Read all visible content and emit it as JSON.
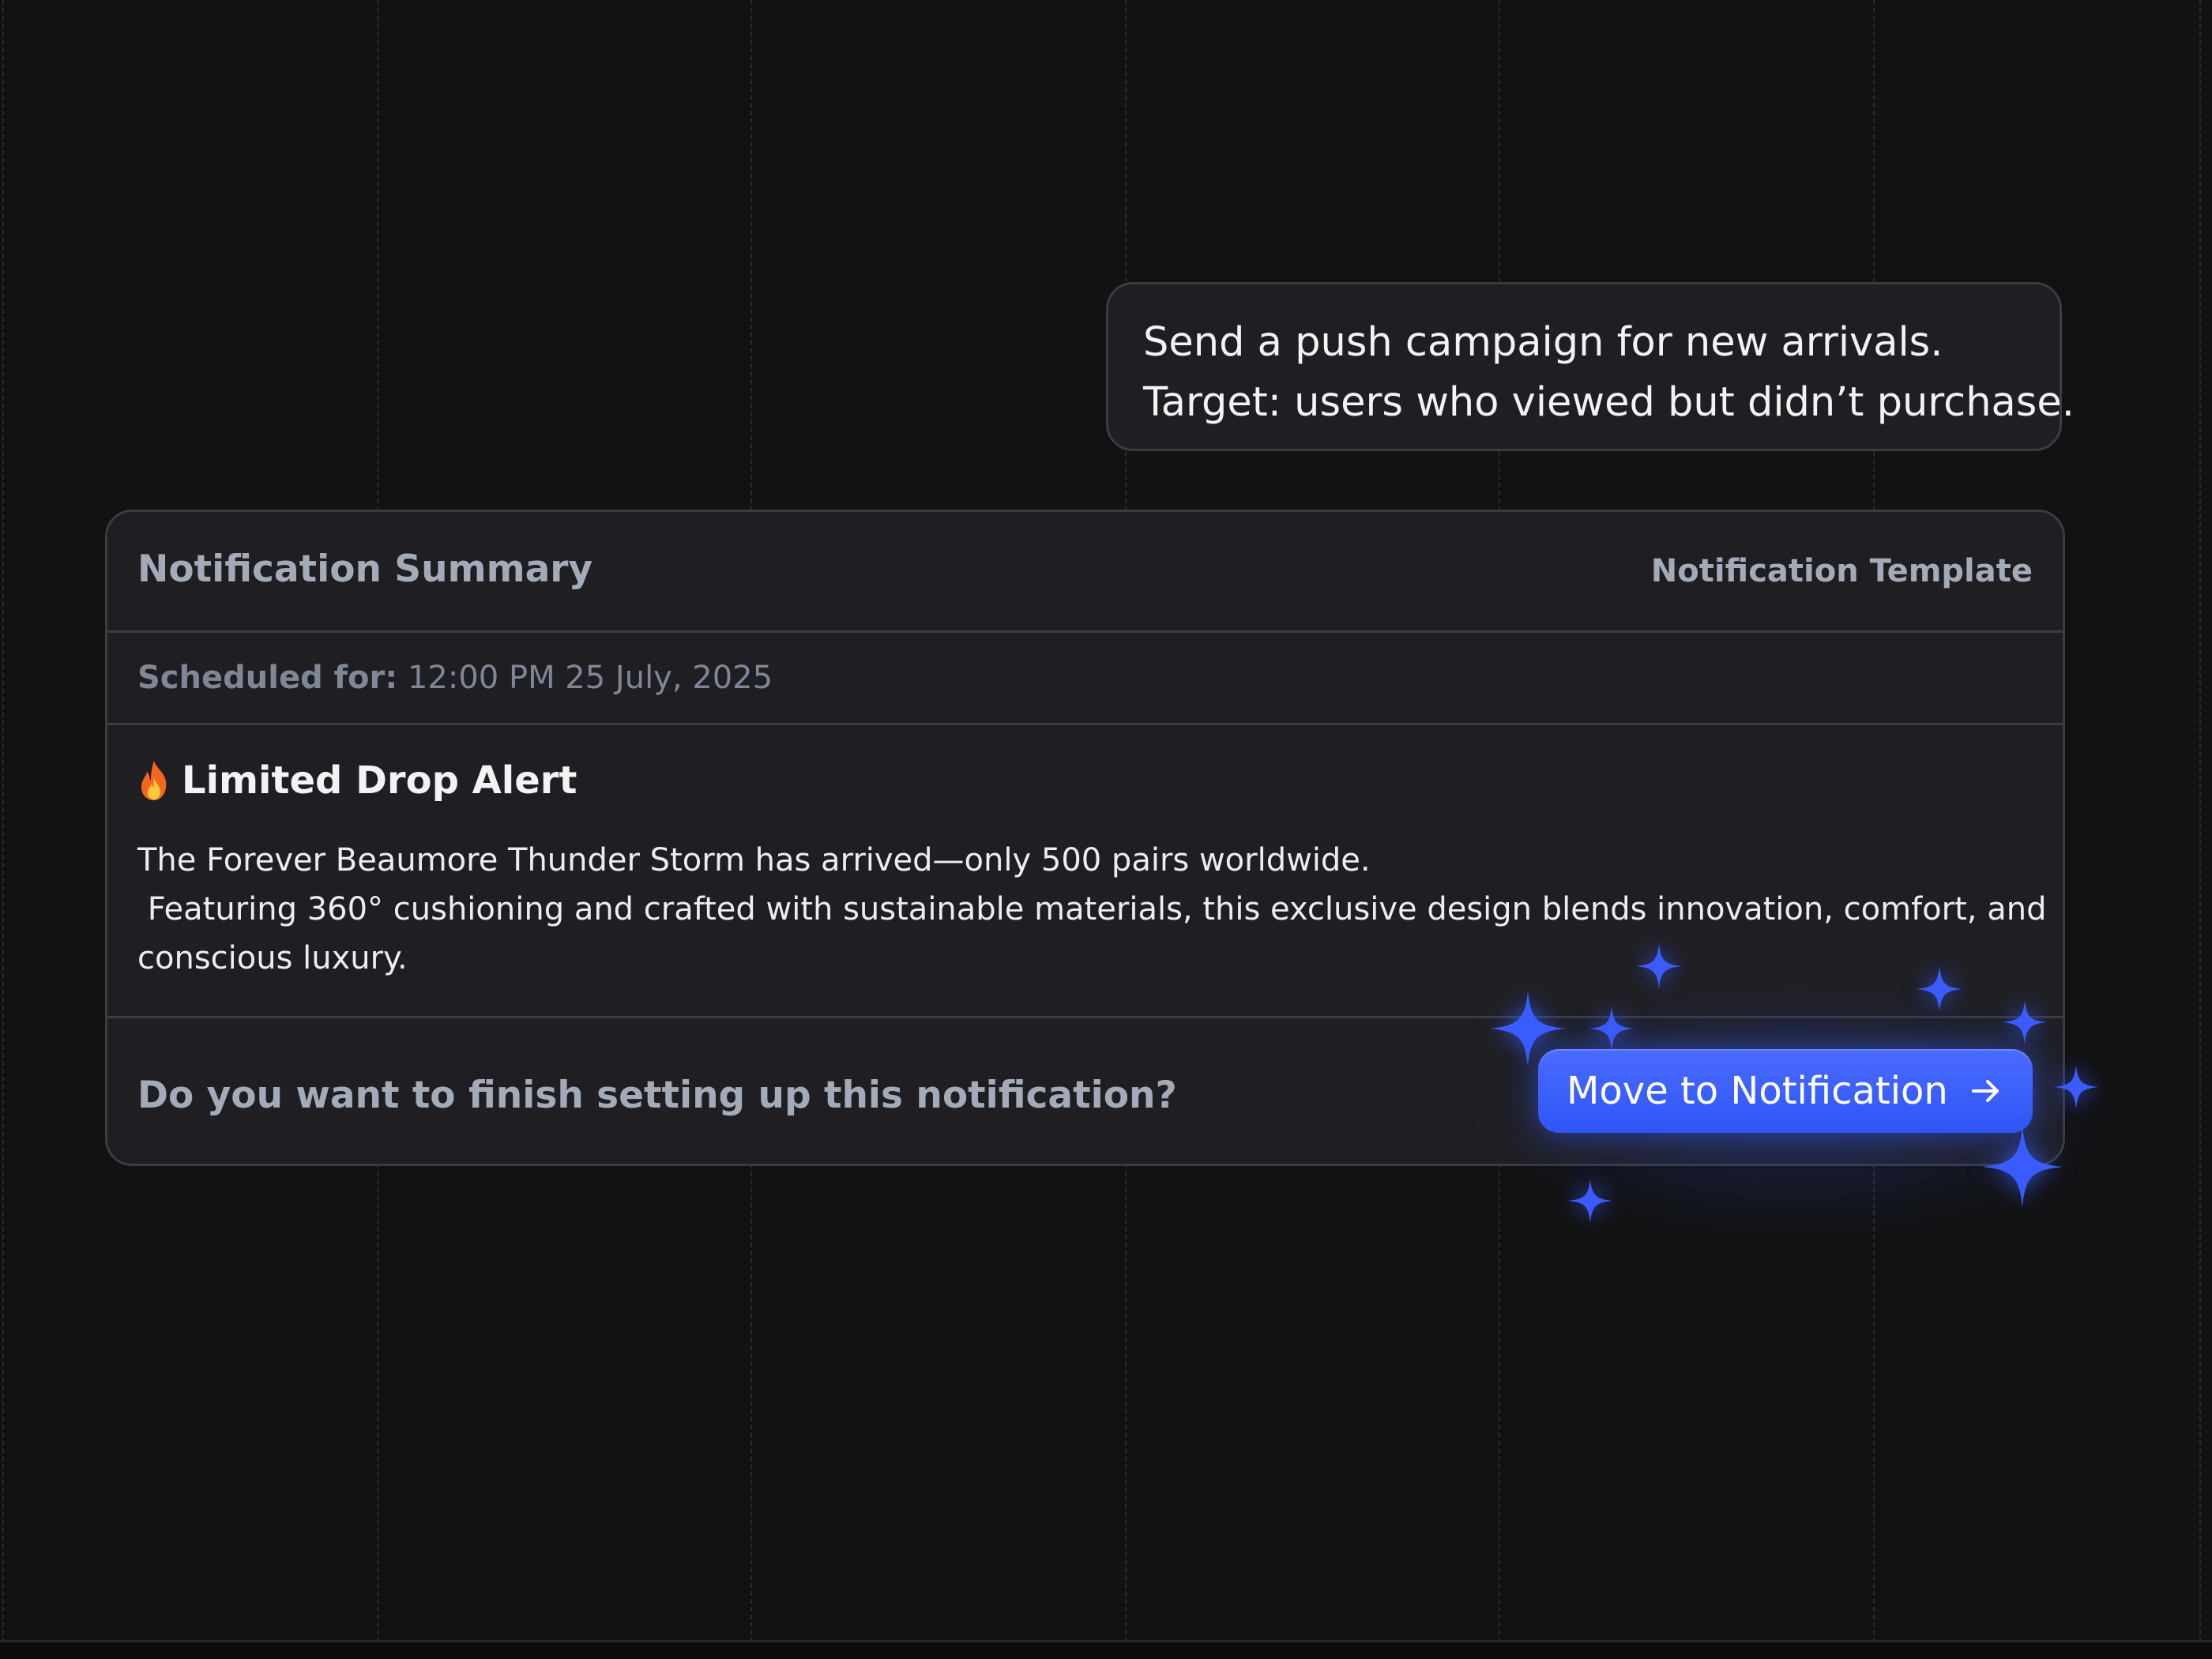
{
  "prompt": {
    "line1": "Send a push campaign for new arrivals.",
    "line2": "Target: users who viewed but didn’t purchase."
  },
  "summary": {
    "title": "Notification Summary",
    "template_link": "Notification Template",
    "scheduled_label": "Scheduled for:",
    "scheduled_value": "12:00 PM 25 July, 2025",
    "headline": "Limited Drop Alert",
    "headline_icon": "fire-icon",
    "body_line1": "The Forever Beaumore Thunder Storm has arrived—only 500 pairs worldwide.",
    "body_line2": " Featuring 360° cushioning and crafted with sustainable materials, this exclusive design blends innovation, comfort, and",
    "body_line3": "conscious luxury.",
    "question": "Do you want to finish setting up this notification?",
    "cta_label": "Move to Notification",
    "cta_icon": "arrow-right-icon"
  },
  "colors": {
    "background": "#121213",
    "card": "#1f1f23",
    "border": "#3b3b41",
    "muted_text": "#a3aab8",
    "accent": "#3a5cff"
  }
}
